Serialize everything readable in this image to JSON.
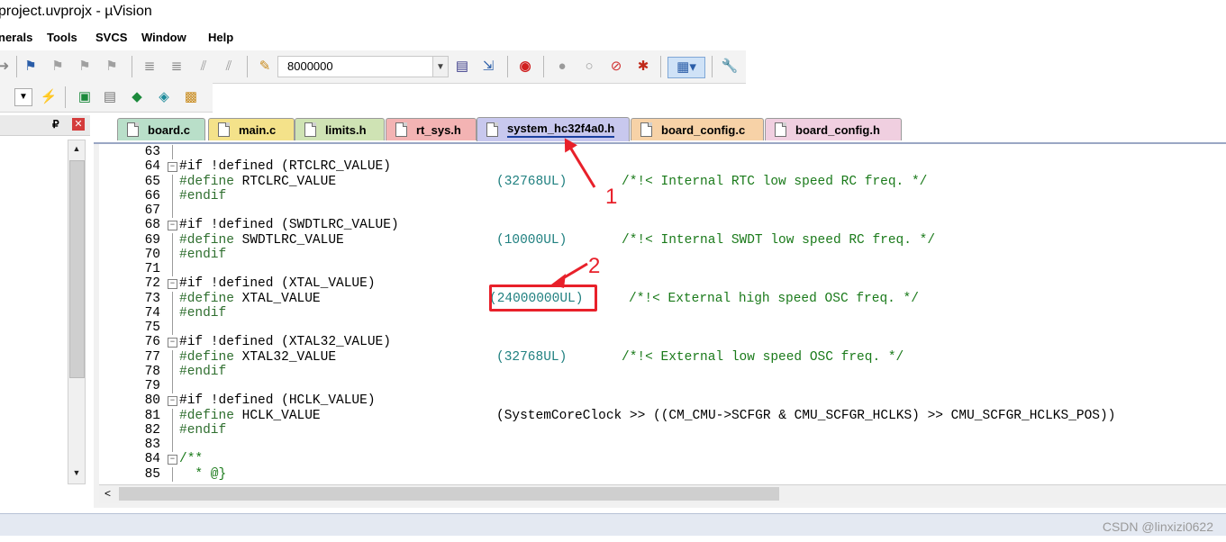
{
  "window": {
    "title": "project.uvprojx - µVision"
  },
  "menu": {
    "items": [
      "nerals",
      "Tools",
      "SVCS",
      "Window",
      "Help"
    ]
  },
  "toolbar": {
    "target_value": "8000000"
  },
  "tabs": [
    {
      "label": "board.c",
      "color": "#b9dfc9"
    },
    {
      "label": "main.c",
      "color": "#f4e28a"
    },
    {
      "label": "limits.h",
      "color": "#cfe3b4"
    },
    {
      "label": "rt_sys.h",
      "color": "#f3b3b3"
    },
    {
      "label": "system_hc32f4a0.h",
      "color": "#c8c8ee",
      "active": true
    },
    {
      "label": "board_config.c",
      "color": "#f7d2a7"
    },
    {
      "label": "board_config.h",
      "color": "#f0cfe0"
    }
  ],
  "code_lines": [
    {
      "n": "63",
      "pre": "",
      "name": "",
      "val": "",
      "cmt": ""
    },
    {
      "n": "64",
      "pre": "#if",
      "name": " !defined (RTCLRC_VALUE)",
      "val": "",
      "cmt": ""
    },
    {
      "n": "65",
      "pre": "#define",
      "name": " RTCLRC_VALUE",
      "val": "(32768UL)",
      "cmt": "/*!< Internal RTC low speed RC freq. */"
    },
    {
      "n": "66",
      "pre": "#endif",
      "name": "",
      "val": "",
      "cmt": ""
    },
    {
      "n": "67",
      "pre": "",
      "name": "",
      "val": "",
      "cmt": ""
    },
    {
      "n": "68",
      "pre": "#if",
      "name": " !defined (SWDTLRC_VALUE)",
      "val": "",
      "cmt": ""
    },
    {
      "n": "69",
      "pre": "#define",
      "name": " SWDTLRC_VALUE",
      "val": "(10000UL)",
      "cmt": "/*!< Internal SWDT low speed RC freq. */"
    },
    {
      "n": "70",
      "pre": "#endif",
      "name": "",
      "val": "",
      "cmt": ""
    },
    {
      "n": "71",
      "pre": "",
      "name": "",
      "val": "",
      "cmt": ""
    },
    {
      "n": "72",
      "pre": "#if",
      "name": " !defined (XTAL_VALUE)",
      "val": "",
      "cmt": ""
    },
    {
      "n": "73",
      "pre": "#define",
      "name": " XTAL_VALUE",
      "val": "(24000000UL)",
      "cmt": "/*!< External high speed OSC freq. */"
    },
    {
      "n": "74",
      "pre": "#endif",
      "name": "",
      "val": "",
      "cmt": ""
    },
    {
      "n": "75",
      "pre": "",
      "name": "",
      "val": "",
      "cmt": ""
    },
    {
      "n": "76",
      "pre": "#if",
      "name": " !defined (XTAL32_VALUE)",
      "val": "",
      "cmt": ""
    },
    {
      "n": "77",
      "pre": "#define",
      "name": " XTAL32_VALUE",
      "val": "(32768UL)",
      "cmt": "/*!< External low speed OSC freq. */"
    },
    {
      "n": "78",
      "pre": "#endif",
      "name": "",
      "val": "",
      "cmt": ""
    },
    {
      "n": "79",
      "pre": "",
      "name": "",
      "val": "",
      "cmt": ""
    },
    {
      "n": "80",
      "pre": "#if",
      "name": " !defined (HCLK_VALUE)",
      "val": "",
      "cmt": ""
    },
    {
      "n": "81",
      "pre": "#define",
      "name": " HCLK_VALUE",
      "val": "(SystemCoreClock >> ((CM_CMU->SCFGR & CMU_SCFGR_HCLKS) >> CMU_SCFGR_HCLKS_POS))",
      "cmt": ""
    },
    {
      "n": "82",
      "pre": "#endif",
      "name": "",
      "val": "",
      "cmt": ""
    },
    {
      "n": "83",
      "pre": "",
      "name": "",
      "val": "",
      "cmt": ""
    },
    {
      "n": "84",
      "pre": "/**",
      "name": "",
      "val": "",
      "cmt": ""
    },
    {
      "n": "85",
      "pre": "  * @}",
      "name": "",
      "val": "",
      "cmt": ""
    }
  ],
  "annotations": {
    "one": "1",
    "two": "2"
  },
  "watermark": "CSDN @linxizi0622",
  "colors": {
    "highlight": "#e8202a",
    "active_tab_underline": "#1a3fa0"
  }
}
